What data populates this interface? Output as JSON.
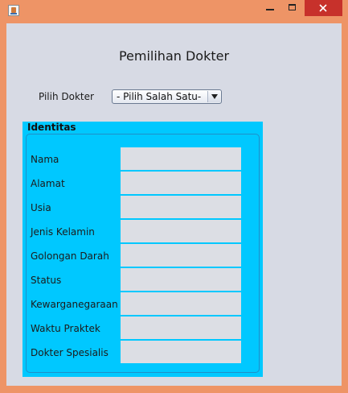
{
  "window": {
    "title": "",
    "close_color": "#c7312b",
    "frame_color": "#ee9466"
  },
  "form": {
    "heading": "Pemilihan Dokter",
    "pick_label": "Pilih Dokter",
    "combo_value": "- Pilih Salah Satu-"
  },
  "identitas": {
    "title": "Identitas",
    "panel_color": "#00c8ff",
    "fields": [
      {
        "label": "Nama",
        "value": ""
      },
      {
        "label": "Alamat",
        "value": ""
      },
      {
        "label": "Usia",
        "value": ""
      },
      {
        "label": "Jenis Kelamin",
        "value": ""
      },
      {
        "label": "Golongan Darah",
        "value": ""
      },
      {
        "label": "Status",
        "value": ""
      },
      {
        "label": "Kewarganegaraan",
        "value": ""
      },
      {
        "label": "Waktu Praktek",
        "value": ""
      },
      {
        "label": "Dokter Spesialis",
        "value": ""
      }
    ]
  }
}
